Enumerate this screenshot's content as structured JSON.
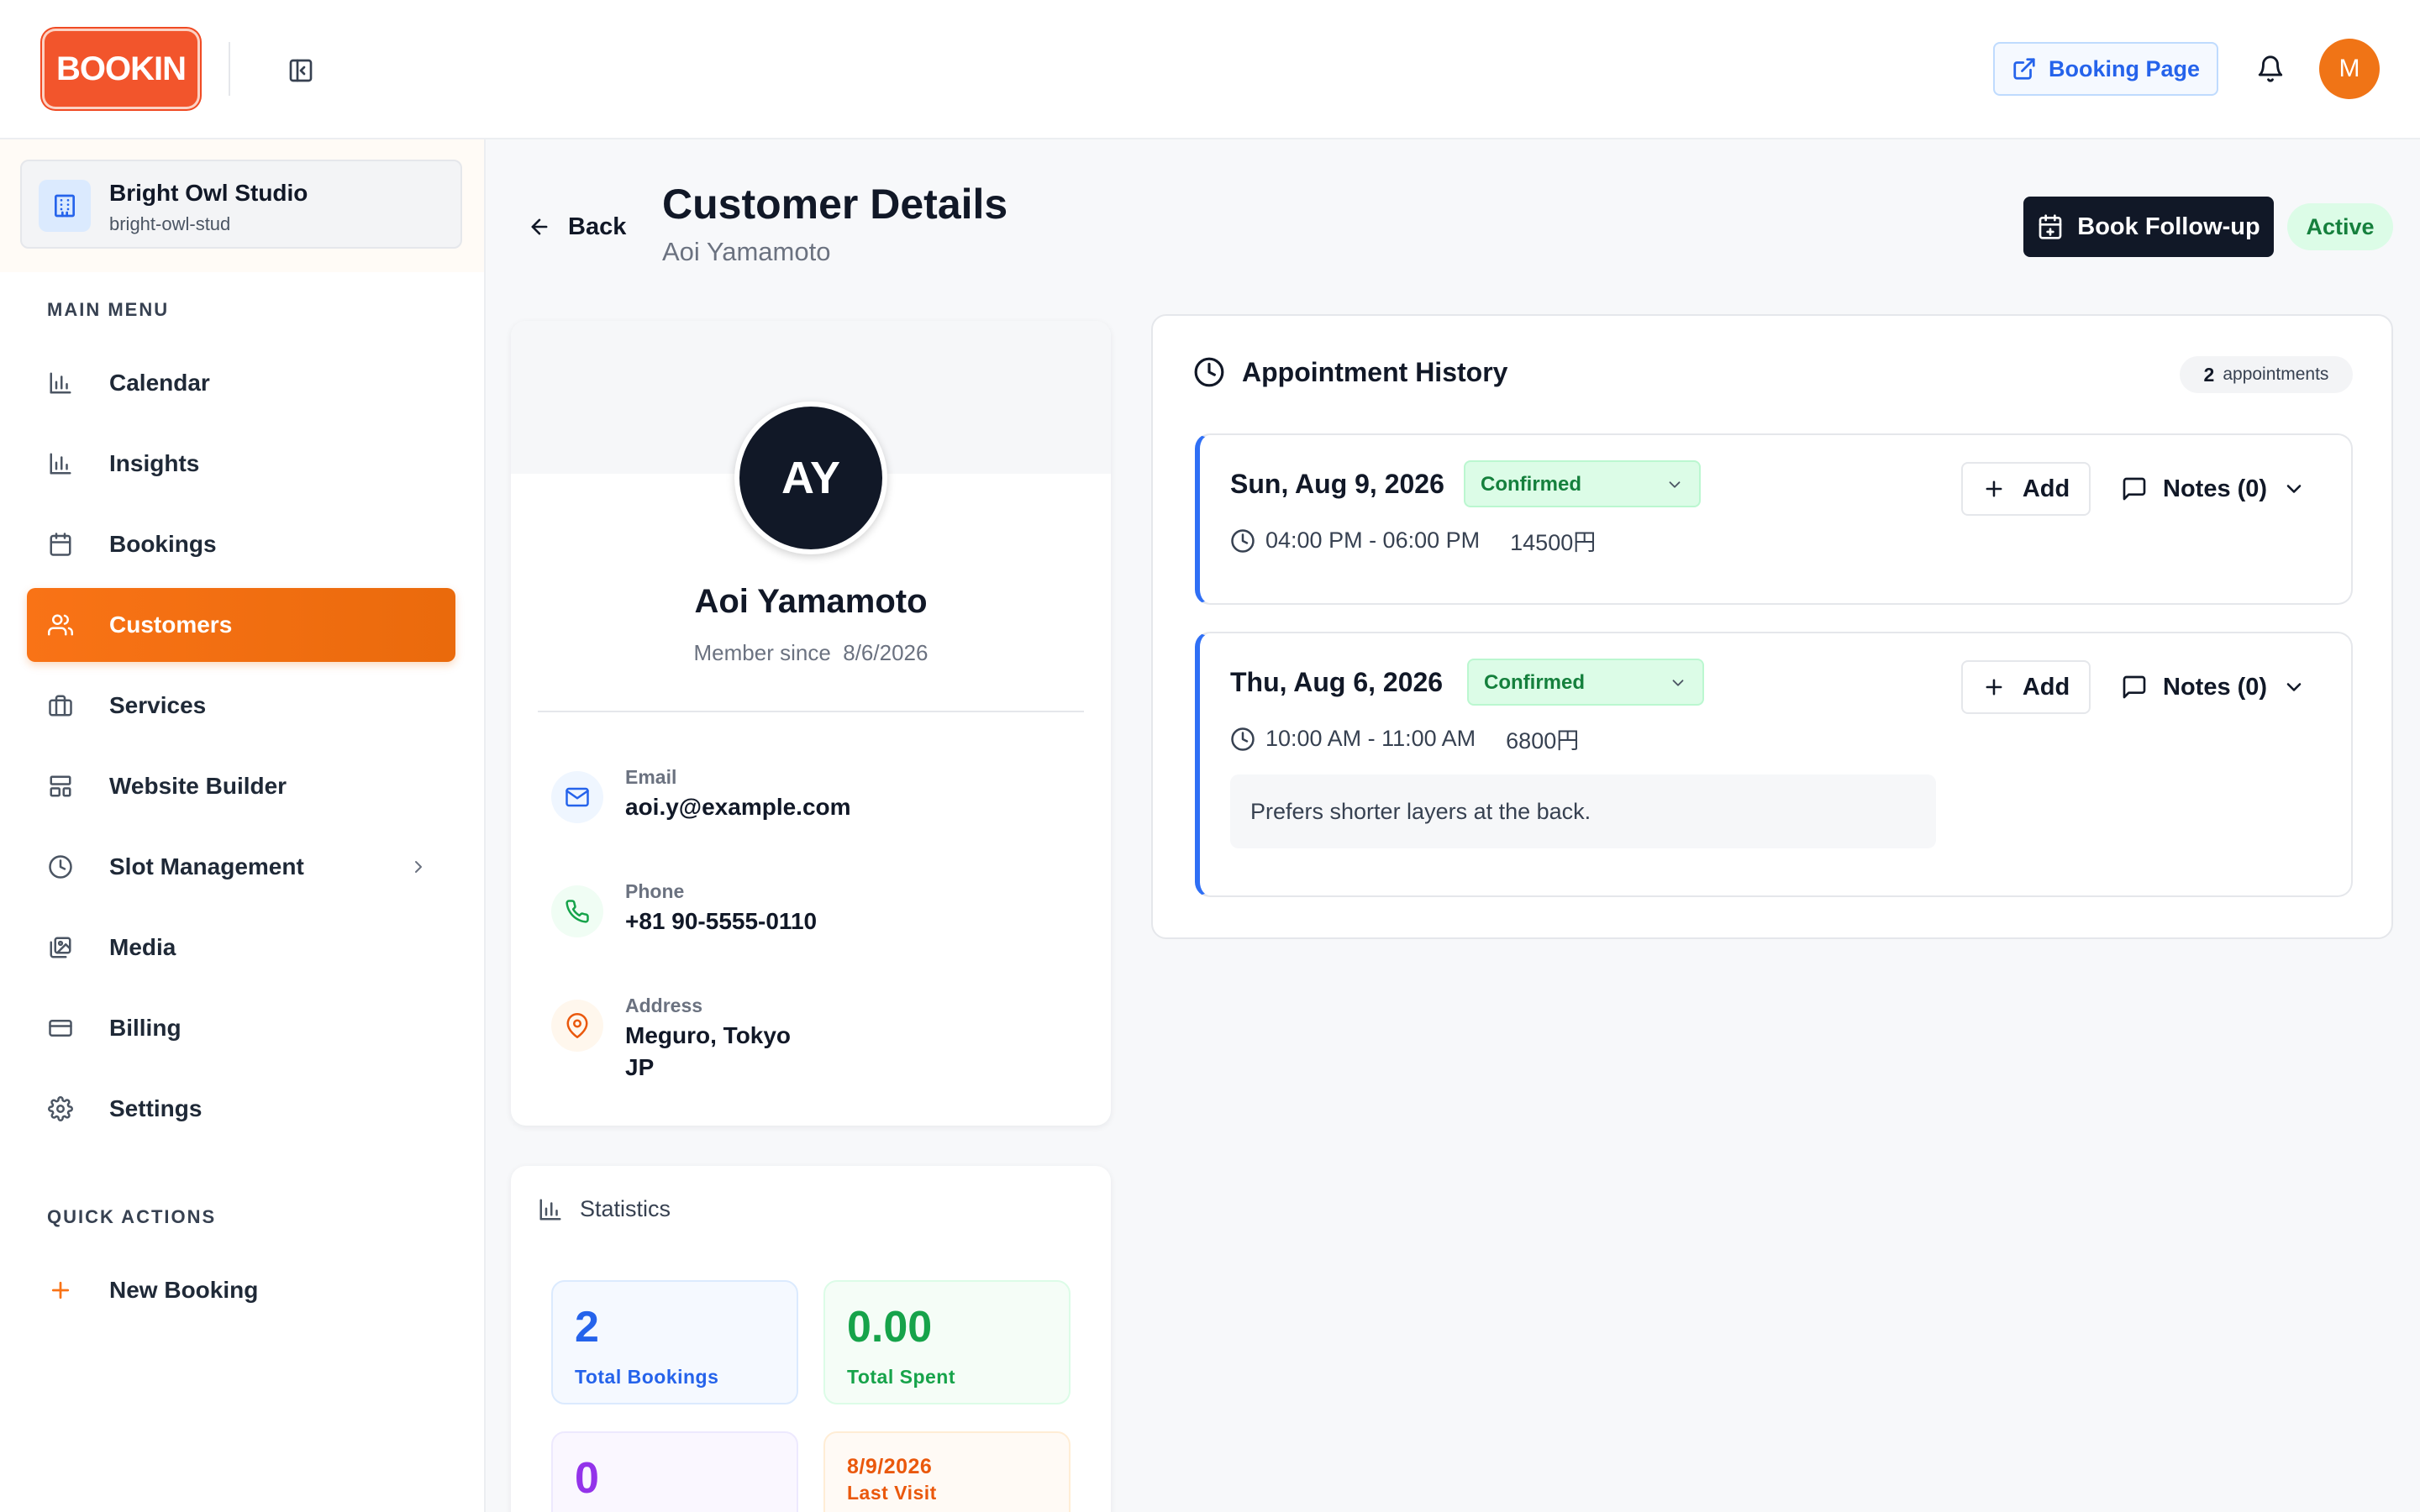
{
  "app": {
    "logo_text": "BOOKIN",
    "booking_page_label": "Booking Page",
    "user_initial": "M"
  },
  "sidebar": {
    "studio": {
      "name": "Bright Owl Studio",
      "slug": "bright-owl-stud"
    },
    "main_menu_label": "MAIN MENU",
    "items": [
      {
        "label": "Calendar",
        "icon": "bar-chart-icon"
      },
      {
        "label": "Insights",
        "icon": "bar-chart-icon"
      },
      {
        "label": "Bookings",
        "icon": "calendar-icon"
      },
      {
        "label": "Customers",
        "icon": "users-icon",
        "active": true
      },
      {
        "label": "Services",
        "icon": "briefcase-icon"
      },
      {
        "label": "Website Builder",
        "icon": "layout-icon"
      },
      {
        "label": "Slot Management",
        "icon": "clock-icon",
        "has_chevron": true
      },
      {
        "label": "Media",
        "icon": "images-icon"
      },
      {
        "label": "Billing",
        "icon": "credit-card-icon"
      },
      {
        "label": "Settings",
        "icon": "gear-icon"
      }
    ],
    "quick_actions_label": "QUICK ACTIONS",
    "quick_actions": [
      {
        "label": "New Booking",
        "icon": "plus-icon"
      }
    ]
  },
  "header": {
    "back_label": "Back",
    "title": "Customer Details",
    "subtitle": "Aoi Yamamoto",
    "follow_up_label": "Book Follow-up",
    "status": "Active"
  },
  "profile": {
    "initials": "AY",
    "name": "Aoi Yamamoto",
    "member_since_label": "Member since",
    "member_since": "8/6/2026",
    "email_label": "Email",
    "email": "aoi.y@example.com",
    "phone_label": "Phone",
    "phone": "+81 90-5555-0110",
    "address_label": "Address",
    "address_line1": "Meguro, Tokyo",
    "address_line2": "JP"
  },
  "statistics": {
    "title": "Statistics",
    "total_bookings": "2",
    "total_bookings_label": "Total Bookings",
    "total_spent": "0.00",
    "total_spent_label": "Total Spent",
    "third_value": "0",
    "last_visit": "8/9/2026",
    "last_visit_label": "Last Visit"
  },
  "history": {
    "title": "Appointment History",
    "count": "2",
    "count_label": "appointments",
    "add_label": "Add",
    "appointments": [
      {
        "date": "Sun, Aug 9, 2026",
        "status": "Confirmed",
        "time": "04:00 PM - 06:00 PM",
        "price": "14500円",
        "notes_label": "Notes (0)"
      },
      {
        "date": "Thu, Aug 6, 2026",
        "status": "Confirmed",
        "time": "10:00 AM - 11:00 AM",
        "price": "6800円",
        "notes_label": "Notes (0)",
        "note": "Prefers shorter layers at the back."
      }
    ]
  },
  "colors": {
    "accent_orange": "#f97316",
    "brand_logo": "#f2552c",
    "primary_blue": "#2563eb",
    "success_green": "#15803d",
    "dark": "#111827"
  }
}
